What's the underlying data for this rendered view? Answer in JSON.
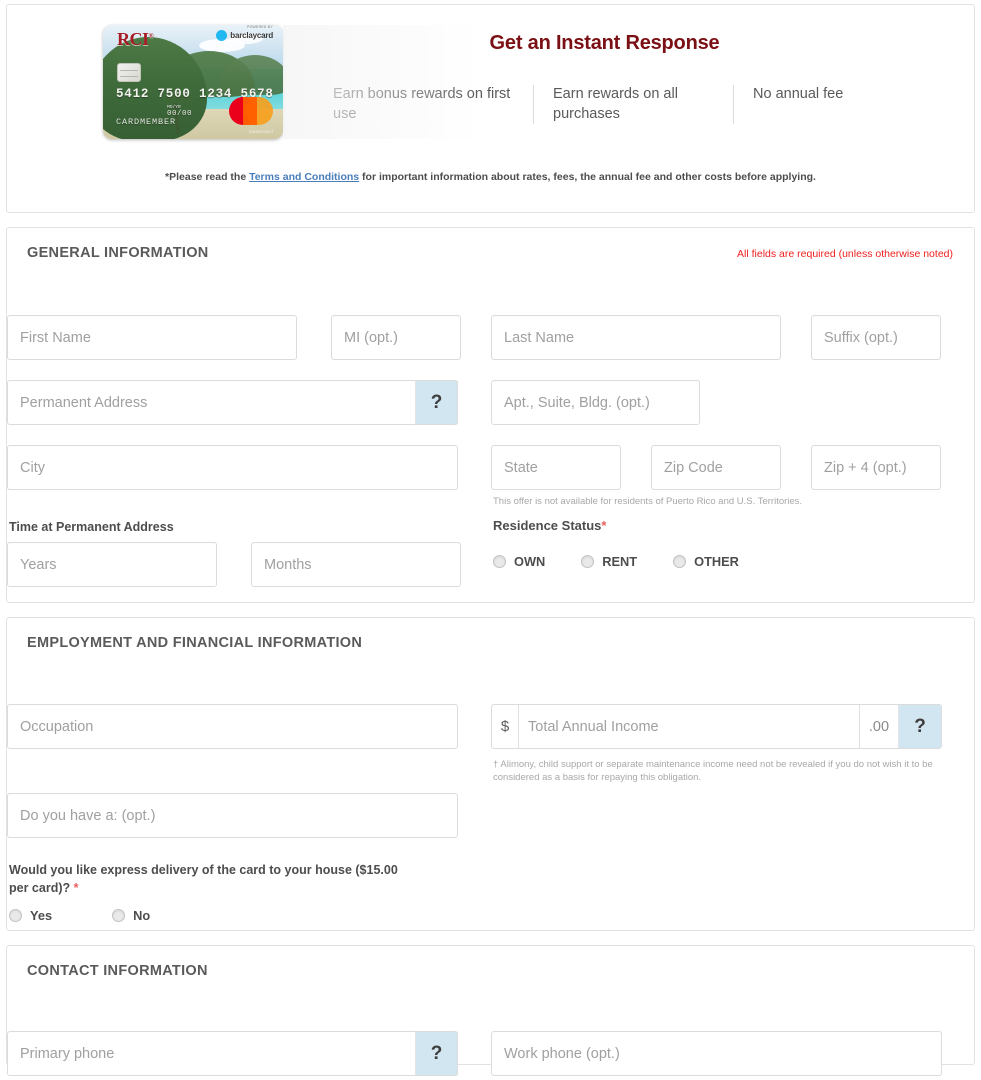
{
  "hero": {
    "title": "Get an Instant Response",
    "card": {
      "brand_logo": "RCI",
      "brand_trademark": "®",
      "powered_by_label": "POWERED BY",
      "issuer_logo": "barclaycard",
      "number": "5412 7500 1234 5678",
      "exp_label": "MO/YR",
      "exp_value": "00/00",
      "holder": "CARDMEMBER",
      "network": "mastercard"
    },
    "benefits": [
      "Earn bonus rewards on first use",
      "Earn rewards on all purchases",
      "No annual fee"
    ],
    "terms": {
      "prefix": "*Please read the ",
      "link": "Terms and Conditions",
      "suffix": " for important information about rates, fees, the annual fee and other costs before applying."
    }
  },
  "general": {
    "heading": "GENERAL INFORMATION",
    "required_note": "All fields are required (unless otherwise noted)",
    "first_name_placeholder": "First Name",
    "mi_placeholder": "MI (opt.)",
    "last_name_placeholder": "Last Name",
    "suffix_placeholder": "Suffix (opt.)",
    "permanent_address_placeholder": "Permanent Address",
    "apt_placeholder": "Apt., Suite, Bldg. (opt.)",
    "city_placeholder": "City",
    "state_placeholder": "State",
    "zip_placeholder": "Zip Code",
    "zip4_placeholder": "Zip + 4 (opt.)",
    "territory_note": "This offer is not available for residents of Puerto Rico and U.S. Territories.",
    "time_at_address_label": "Time at Permanent Address",
    "years_placeholder": "Years",
    "months_placeholder": "Months",
    "residence_status_label": "Residence Status",
    "residence_required_mark": "*",
    "residence_options": [
      "OWN",
      "RENT",
      "OTHER"
    ],
    "help_icon": "question-mark-icon"
  },
  "employment": {
    "heading": "EMPLOYMENT AND FINANCIAL INFORMATION",
    "occupation_placeholder": "Occupation",
    "income_currency": "$",
    "income_placeholder": "Total Annual Income",
    "income_cents": ".00",
    "income_footnote": "† Alimony, child support or separate maintenance income need not be revealed if you do not wish it to be considered as a basis for repaying this obligation.",
    "do_you_have_placeholder": "Do you have a: (opt.)",
    "express_question": "Would you like express delivery of the card to your house ($15.00 per card)?",
    "express_required_mark": "*",
    "express_options": [
      "Yes",
      "No"
    ],
    "help_icon": "question-mark-icon"
  },
  "contact": {
    "heading": "CONTACT INFORMATION",
    "primary_phone_placeholder": "Primary phone",
    "work_phone_placeholder": "Work phone (opt.)",
    "help_icon": "question-mark-icon"
  },
  "colors": {
    "title_maroon": "#7b1014",
    "required_red": "#f02020",
    "help_blue": "#d2e6f2",
    "link_blue": "#4a7ebb",
    "label_gray": "#4d4d4d",
    "placeholder_gray": "#a0a0a0",
    "border_gray": "#dcdcdc"
  }
}
